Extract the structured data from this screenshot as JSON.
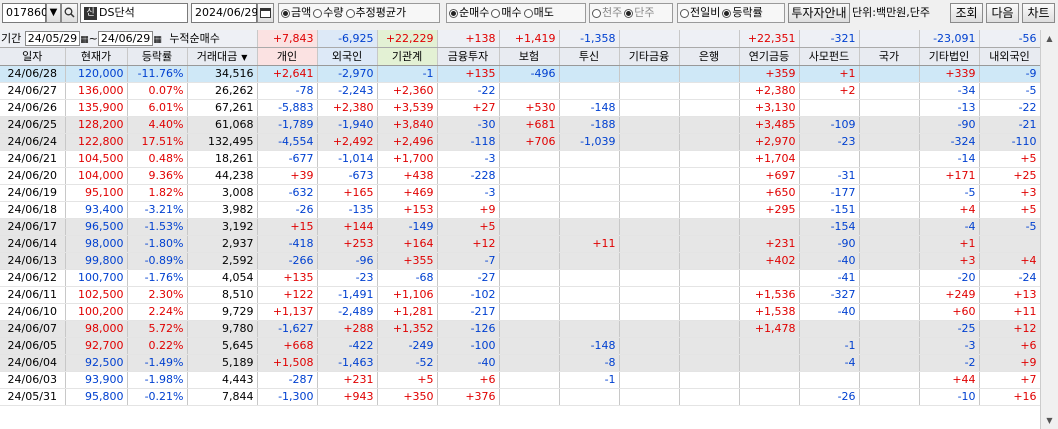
{
  "toolbar": {
    "code": "017860",
    "badge": "신",
    "name": "DS단석",
    "date": "2024/06/29",
    "radio_a": [
      {
        "label": "금액",
        "on": true
      },
      {
        "label": "수량",
        "on": false
      },
      {
        "label": "추정평균가",
        "on": false
      }
    ],
    "radio_b": [
      {
        "label": "순매수",
        "on": true
      },
      {
        "label": "매수",
        "on": false
      },
      {
        "label": "매도",
        "on": false
      }
    ],
    "radio_c": [
      {
        "label": "천주",
        "on": false,
        "dis": true
      },
      {
        "label": "단주",
        "on": true,
        "dis": true
      }
    ],
    "radio_d": [
      {
        "label": "전일비",
        "on": false
      },
      {
        "label": "등락률",
        "on": true
      }
    ],
    "guide_button": "투자자안내",
    "unit": "단위:백만원,단주",
    "query_button": "조회",
    "next_button": "다음",
    "chart_button": "차트"
  },
  "period": {
    "label": "기간",
    "from": "24/05/29",
    "to": "24/06/29",
    "cum_label": "누적순매수",
    "values": [
      "+7,843",
      "-6,925",
      "+22,229",
      "+138",
      "+1,419",
      "-1,358",
      "",
      "",
      "+22,351",
      "-321",
      "",
      "-23,091",
      "-56"
    ]
  },
  "headers": [
    "일자",
    "현재가",
    "등락률",
    "거래대금",
    "개인",
    "외국인",
    "기관계",
    "금융투자",
    "보험",
    "투신",
    "기타금융",
    "은행",
    "연기금등",
    "사모펀드",
    "국가",
    "기타법인",
    "내외국인"
  ],
  "rows": [
    [
      "24/06/28",
      "120,000",
      "-11.76%",
      "34,516",
      "+2,641",
      "-2,970",
      "-1",
      "+135",
      "-496",
      "",
      "",
      "",
      "+359",
      "+1",
      "",
      "+339",
      "-9"
    ],
    [
      "24/06/27",
      "136,000",
      "0.07%",
      "26,262",
      "-78",
      "-2,243",
      "+2,360",
      "-22",
      "",
      "",
      "",
      "",
      "+2,380",
      "+2",
      "",
      "-34",
      "-5"
    ],
    [
      "24/06/26",
      "135,900",
      "6.01%",
      "67,261",
      "-5,883",
      "+2,380",
      "+3,539",
      "+27",
      "+530",
      "-148",
      "",
      "",
      "+3,130",
      "",
      "",
      "-13",
      "-22"
    ],
    [
      "24/06/25",
      "128,200",
      "4.40%",
      "61,068",
      "-1,789",
      "-1,940",
      "+3,840",
      "-30",
      "+681",
      "-188",
      "",
      "",
      "+3,485",
      "-109",
      "",
      "-90",
      "-21"
    ],
    [
      "24/06/24",
      "122,800",
      "17.51%",
      "132,495",
      "-4,554",
      "+2,492",
      "+2,496",
      "-118",
      "+706",
      "-1,039",
      "",
      "",
      "+2,970",
      "-23",
      "",
      "-324",
      "-110"
    ],
    [
      "24/06/21",
      "104,500",
      "0.48%",
      "18,261",
      "-677",
      "-1,014",
      "+1,700",
      "-3",
      "",
      "",
      "",
      "",
      "+1,704",
      "",
      "",
      "-14",
      "+5"
    ],
    [
      "24/06/20",
      "104,000",
      "9.36%",
      "44,238",
      "+39",
      "-673",
      "+438",
      "-228",
      "",
      "",
      "",
      "",
      "+697",
      "-31",
      "",
      "+171",
      "+25"
    ],
    [
      "24/06/19",
      "95,100",
      "1.82%",
      "3,008",
      "-632",
      "+165",
      "+469",
      "-3",
      "",
      "",
      "",
      "",
      "+650",
      "-177",
      "",
      "-5",
      "+3"
    ],
    [
      "24/06/18",
      "93,400",
      "-3.21%",
      "3,982",
      "-26",
      "-135",
      "+153",
      "+9",
      "",
      "",
      "",
      "",
      "+295",
      "-151",
      "",
      "+4",
      "+5"
    ],
    [
      "24/06/17",
      "96,500",
      "-1.53%",
      "3,192",
      "+15",
      "+144",
      "-149",
      "+5",
      "",
      "",
      "",
      "",
      "",
      "-154",
      "",
      "-4",
      "-5"
    ],
    [
      "24/06/14",
      "98,000",
      "-1.80%",
      "2,937",
      "-418",
      "+253",
      "+164",
      "+12",
      "",
      "+11",
      "",
      "",
      "+231",
      "-90",
      "",
      "+1",
      ""
    ],
    [
      "24/06/13",
      "99,800",
      "-0.89%",
      "2,592",
      "-266",
      "-96",
      "+355",
      "-7",
      "",
      "",
      "",
      "",
      "+402",
      "-40",
      "",
      "+3",
      "+4"
    ],
    [
      "24/06/12",
      "100,700",
      "-1.76%",
      "4,054",
      "+135",
      "-23",
      "-68",
      "-27",
      "",
      "",
      "",
      "",
      "",
      "-41",
      "",
      "-20",
      "-24"
    ],
    [
      "24/06/11",
      "102,500",
      "2.30%",
      "8,510",
      "+122",
      "-1,491",
      "+1,106",
      "-102",
      "",
      "",
      "",
      "",
      "+1,536",
      "-327",
      "",
      "+249",
      "+13"
    ],
    [
      "24/06/10",
      "100,200",
      "2.24%",
      "9,729",
      "+1,137",
      "-2,489",
      "+1,281",
      "-217",
      "",
      "",
      "",
      "",
      "+1,538",
      "-40",
      "",
      "+60",
      "+11"
    ],
    [
      "24/06/07",
      "98,000",
      "5.72%",
      "9,780",
      "-1,627",
      "+288",
      "+1,352",
      "-126",
      "",
      "",
      "",
      "",
      "+1,478",
      "",
      "",
      "-25",
      "+12"
    ],
    [
      "24/06/05",
      "92,700",
      "0.22%",
      "5,645",
      "+668",
      "-422",
      "-249",
      "-100",
      "",
      "-148",
      "",
      "",
      "",
      "-1",
      "",
      "-3",
      "+6"
    ],
    [
      "24/06/04",
      "92,500",
      "-1.49%",
      "5,189",
      "+1,508",
      "-1,463",
      "-52",
      "-40",
      "",
      "-8",
      "",
      "",
      "",
      "-4",
      "",
      "-2",
      "+9"
    ],
    [
      "24/06/03",
      "93,900",
      "-1.98%",
      "4,443",
      "-287",
      "+231",
      "+5",
      "+6",
      "",
      "-1",
      "",
      "",
      "",
      "",
      "",
      "+44",
      "+7"
    ],
    [
      "24/05/31",
      "95,800",
      "-0.21%",
      "7,844",
      "-1,300",
      "+943",
      "+350",
      "+376",
      "",
      "",
      "",
      "",
      "",
      "-26",
      "",
      "-10",
      "+16"
    ]
  ],
  "colors": {
    "up": "#e00000",
    "down": "#0040d0",
    "selected_row": "#cfe8f7",
    "alt_row": "#e6e6e6"
  }
}
